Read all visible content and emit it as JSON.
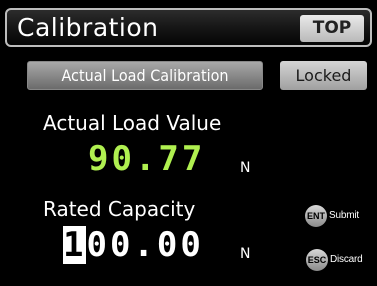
{
  "header": {
    "title": "Calibration",
    "top_button": "TOP"
  },
  "mode": {
    "button_label": "Actual Load Calibration",
    "status": "Locked"
  },
  "actual_load": {
    "label": "Actual Load Value",
    "value": "90.77",
    "unit": "N"
  },
  "rated_capacity": {
    "label": "Rated Capacity",
    "cursor_digit": "1",
    "value_rest": "00.00",
    "unit": "N"
  },
  "hints": {
    "submit": {
      "key": "ENT",
      "text": "Submit"
    },
    "discard": {
      "key": "ESC",
      "text": "Discard"
    }
  }
}
